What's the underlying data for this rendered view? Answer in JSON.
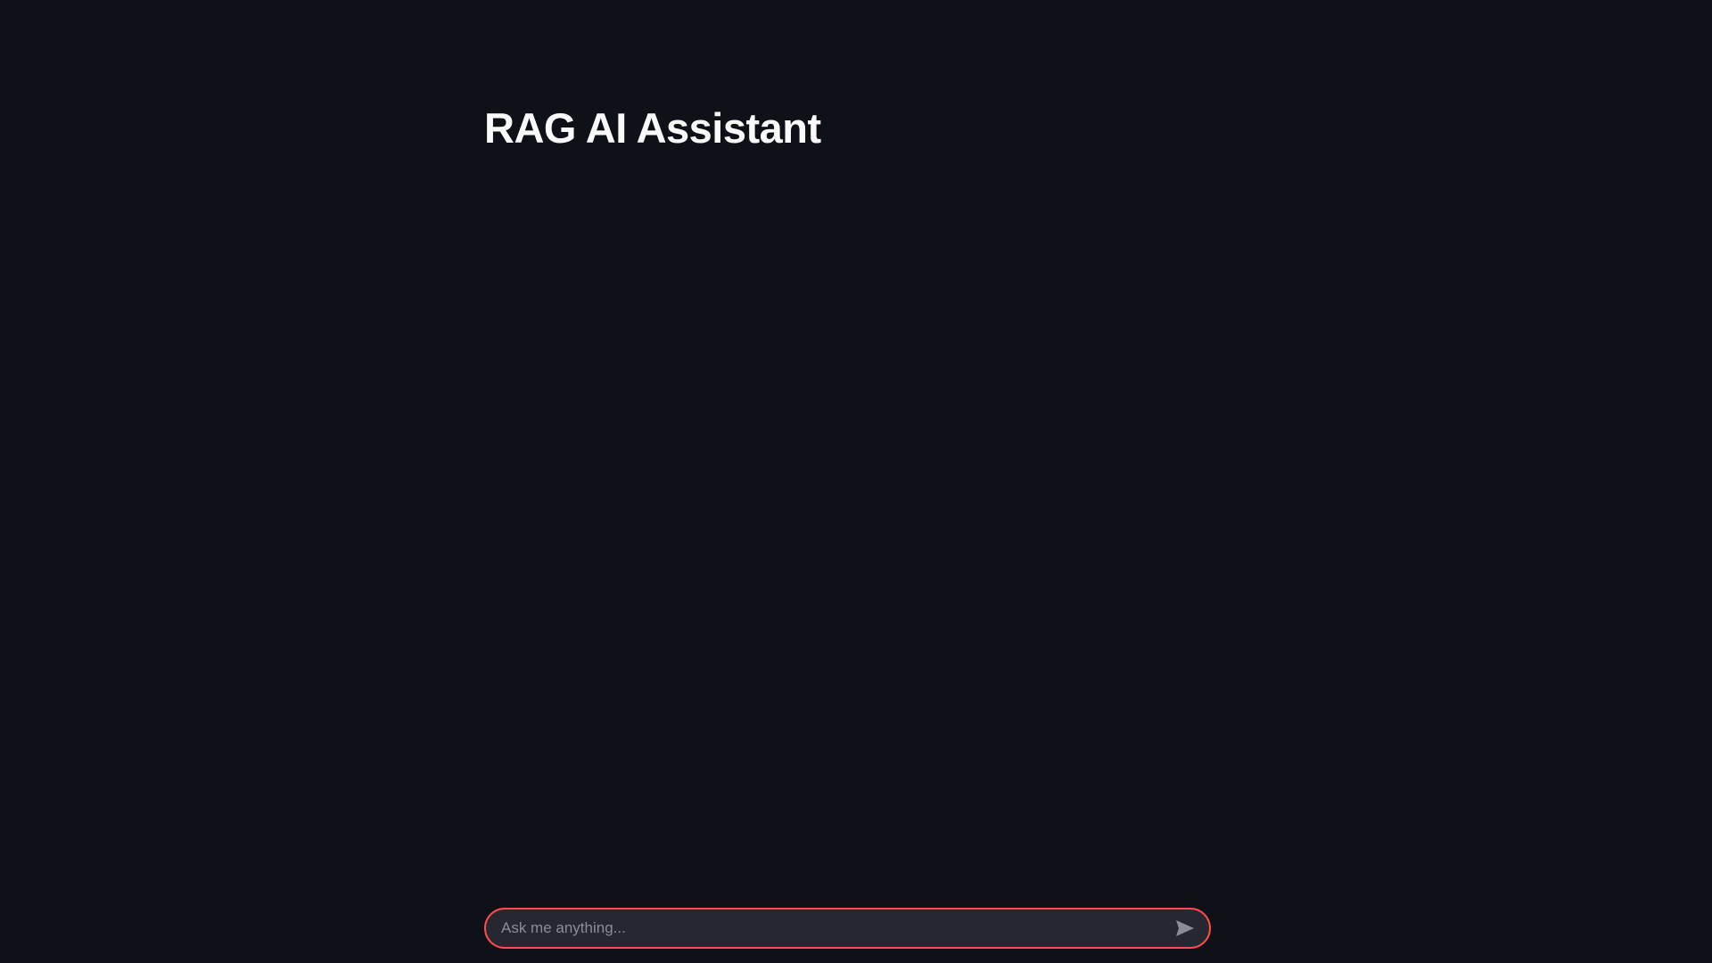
{
  "page": {
    "title": "RAG AI Assistant"
  },
  "chat": {
    "placeholder": "Ask me anything...",
    "value": ""
  },
  "icons": {
    "send": "send-icon"
  },
  "colors": {
    "background": "#0e1117",
    "input_background": "#262730",
    "accent": "#ff4b4b",
    "text": "#fafafa",
    "placeholder": "#8b8d96"
  }
}
